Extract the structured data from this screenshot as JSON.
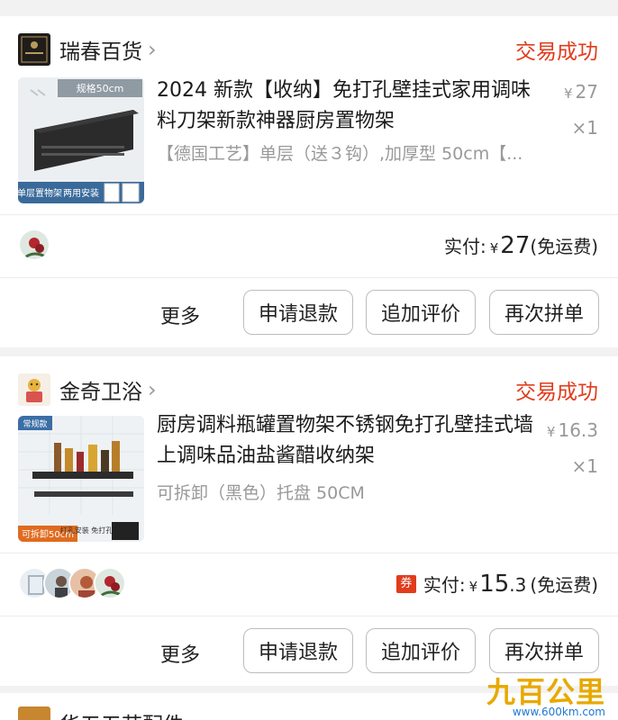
{
  "orders": [
    {
      "shop_name": "瑞春百货",
      "status": "交易成功",
      "item": {
        "title": "2024 新款【收纳】免打孔壁挂式家用调味料刀架新款神器厨房置物架",
        "sku": "【德国工艺】单层（送３钩）,加厚型 50cm【...",
        "price_symbol": "¥",
        "price": "27",
        "qty": "×1",
        "thumb_badge_top": "规格50cm",
        "thumb_badge_left": "单层置物架",
        "thumb_badge_right": "两用安装"
      },
      "paid_label": "实付:",
      "paid_symbol": "¥",
      "paid_amount": "27",
      "shipping": "(免运费)",
      "more_label": "更多",
      "buttons": [
        "申请退款",
        "追加评价",
        "再次拼单"
      ]
    },
    {
      "shop_name": "金奇卫浴",
      "status": "交易成功",
      "item": {
        "title": "厨房调料瓶罐置物架不锈钢免打孔壁挂式墙上调味品油盐酱醋收纳架",
        "sku": "可拆卸（黑色）托盘 50CM",
        "price_symbol": "¥",
        "price": "16.3",
        "qty": "×1",
        "thumb_badge_top": "常规款",
        "thumb_badge_left": "可拆卸50cm",
        "thumb_badge_right": "打孔安装 免打孔安装"
      },
      "coupon_label": "券",
      "paid_label": "实付:",
      "paid_symbol": "¥",
      "paid_amount_int": "15",
      "paid_amount_dec": ".3",
      "shipping": "(免运费)",
      "more_label": "更多",
      "buttons": [
        "申请退款",
        "追加评价",
        "再次拼单"
      ]
    },
    {
      "shop_name": "华五五苗配件"
    }
  ],
  "watermark": {
    "brand": "九百公里",
    "url": "www.600km.com"
  },
  "colors": {
    "status": "#e03c1d",
    "background": "#f2f2f2",
    "price_gray": "#999999"
  }
}
